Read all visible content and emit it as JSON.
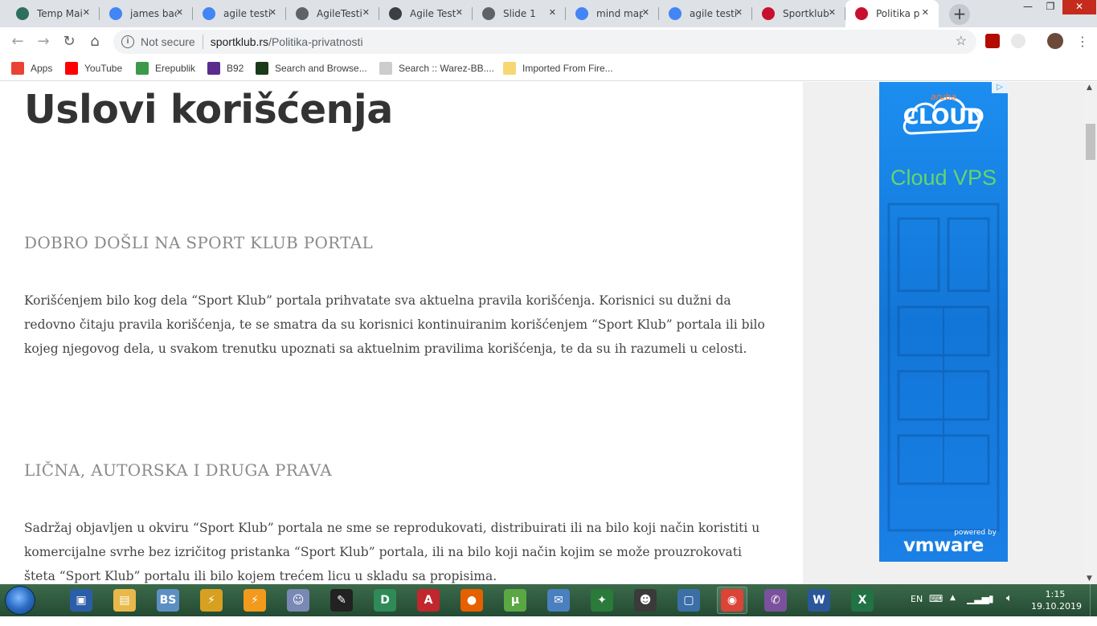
{
  "browser": {
    "tabs": [
      {
        "title": "Temp Mai",
        "icon": "temp-mail-icon",
        "color": "#2d6e5f"
      },
      {
        "title": "james bac",
        "icon": "google-icon",
        "color": "#4285f4"
      },
      {
        "title": "agile testi",
        "icon": "google-icon",
        "color": "#4285f4"
      },
      {
        "title": "AgileTesti",
        "icon": "globe-icon",
        "color": "#5f6368"
      },
      {
        "title": "Agile Test",
        "icon": "book-icon",
        "color": "#3c4043"
      },
      {
        "title": "Slide 1",
        "icon": "globe-icon",
        "color": "#5f6368"
      },
      {
        "title": "mind map",
        "icon": "google-icon",
        "color": "#4285f4"
      },
      {
        "title": "agile testi",
        "icon": "google-icon",
        "color": "#4285f4"
      },
      {
        "title": "Sportklub",
        "icon": "sportklub-icon",
        "color": "#c8102e"
      },
      {
        "title": "Politika p",
        "icon": "sportklub-icon",
        "color": "#c8102e",
        "active": true
      }
    ],
    "address": {
      "security": "Not secure",
      "host": "sportklub.rs",
      "path": "/Politika-privatnosti"
    },
    "bookmarks": [
      {
        "label": "Apps",
        "icon": "apps-grid-icon"
      },
      {
        "label": "YouTube",
        "icon": "youtube-icon"
      },
      {
        "label": "Erepublik",
        "icon": "erepublik-icon"
      },
      {
        "label": "B92",
        "icon": "b92-icon"
      },
      {
        "label": "Search and Browse...",
        "icon": "search-browse-icon"
      },
      {
        "label": "Search :: Warez-BB....",
        "icon": "warez-icon"
      },
      {
        "label": "Imported From Fire...",
        "icon": "folder-icon"
      }
    ]
  },
  "page": {
    "title": "Uslovi korišćenja",
    "sections": [
      {
        "heading": "DOBRO DOŠLI NA SPORT KLUB PORTAL",
        "body": "Korišćenjem bilo kog dela “Sport Klub” portala prihvatate sva aktuelna pravila korišćenja. Korisnici su dužni da redovno čitaju pravila korišćenja, te se smatra da su korisnici kontinuiranim korišćenjem “Sport Klub” portala ili bilo kojeg njegovog dela, u svakom trenutku upoznati sa aktuelnim pravilima korišćenja, te da su ih razumeli u celosti."
      },
      {
        "heading": "LIČNA, AUTORSKA I DRUGA PRAVA",
        "body": "Sadržaj objavljen u okviru “Sport Klub” portala ne sme se reprodukovati, distribuirati ili na bilo koji način koristiti u komercijalne svrhe bez izričitog pristanka “Sport Klub” portala, ili na bilo koji način kojim se može prouzrokovati šteta “Sport Klub” portalu ili bilo kojem trećem licu u skladu sa propisima."
      }
    ]
  },
  "ad": {
    "brand_small": "aruba",
    "brand": "CLOUD",
    "headline": "Cloud VPS",
    "powered_by": "powered by",
    "partner": "vmware",
    "accent": "#64d66a"
  },
  "taskbar": {
    "language": "EN",
    "time": "1:15",
    "date": "19.10.2019",
    "apps": [
      {
        "name": "save-drive-icon",
        "color": "#2b5ea8",
        "glyph": "▣"
      },
      {
        "name": "file-explorer-icon",
        "color": "#e8b84a",
        "glyph": "▤"
      },
      {
        "name": "bluestacks-icon",
        "color": "#5c8fc4",
        "glyph": "BS"
      },
      {
        "name": "winamp-icon",
        "color": "#d8a020",
        "glyph": "⚡"
      },
      {
        "name": "flash-icon",
        "color": "#f29a1c",
        "glyph": "⚡"
      },
      {
        "name": "game-icon",
        "color": "#7a88b5",
        "glyph": "☺"
      },
      {
        "name": "inkscape-icon",
        "color": "#222",
        "glyph": "✎"
      },
      {
        "name": "d-app-icon",
        "color": "#2e8b57",
        "glyph": "D"
      },
      {
        "name": "autocad-icon",
        "color": "#c1272d",
        "glyph": "A"
      },
      {
        "name": "firefox-icon",
        "color": "#e66000",
        "glyph": "●"
      },
      {
        "name": "utorrent-icon",
        "color": "#5ba744",
        "glyph": "µ"
      },
      {
        "name": "thunderbird-icon",
        "color": "#4a7fc0",
        "glyph": "✉"
      },
      {
        "name": "lol-icon",
        "color": "#2a7a3a",
        "glyph": "✦"
      },
      {
        "name": "skull-app-icon",
        "color": "#3a3a3a",
        "glyph": "☻"
      },
      {
        "name": "square-app-icon",
        "color": "#3b6fa8",
        "glyph": "▢"
      },
      {
        "name": "chrome-icon",
        "color": "#db4437",
        "glyph": "◉",
        "open": true
      },
      {
        "name": "viber-icon",
        "color": "#7b519d",
        "glyph": "✆"
      },
      {
        "name": "word-icon",
        "color": "#2b579a",
        "glyph": "W"
      },
      {
        "name": "excel-icon",
        "color": "#217346",
        "glyph": "X"
      }
    ]
  }
}
